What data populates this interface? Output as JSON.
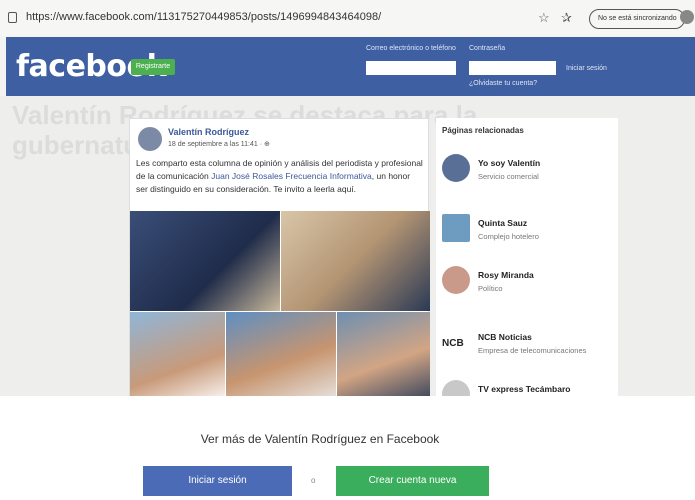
{
  "browser": {
    "url": "https://www.facebook.com/113175270449853/posts/1496994843464098/",
    "profile_status": "No se está sincronizando",
    "icons": [
      "lock-icon",
      "favorite-star-icon",
      "favorites-bar-icon",
      "collections-icon",
      "profile-avatar-icon"
    ]
  },
  "header": {
    "logo": "facebook",
    "register_button": "Registrarte",
    "email_label": "Correo electrónico o teléfono",
    "password_label": "Contraseña",
    "forgot_link": "¿Olvidaste tu cuenta?",
    "login_link": "Iniciar sesión",
    "background_color": "#3f5fa3"
  },
  "background_title": "Valentín Rodríguez se destaca para la gubernatura",
  "post": {
    "author": "Valentín Rodríguez",
    "date": "18 de septiembre a las 11:41 · ",
    "text_before": "Les comparto esta columna de opinión y análisis del periodista y profesional de la comunicación ",
    "mention": "Juan José Rosales Frecuencia Informativa",
    "text_after": ", un honor ser distinguido en su consideración. Te invito a leerla aquí."
  },
  "related_pages": {
    "heading": "Páginas relacionadas",
    "items": [
      {
        "name": "Yo soy Valentín",
        "category": "Servicio comercial"
      },
      {
        "name": "Quinta Sauz",
        "category": "Complejo hotelero"
      },
      {
        "name": "Rosy Miranda",
        "category": "Político"
      },
      {
        "name": "NCB Noticias",
        "category": "Empresa de telecomunicaciones",
        "thumb_label": "NCB"
      },
      {
        "name": "TV express Tecámbaro",
        "category": ""
      }
    ]
  },
  "modal": {
    "title": "Ver más de Valentín Rodríguez en Facebook",
    "login_button": "Iniciar sesión",
    "or_text": "o",
    "create_button": "Crear cuenta nueva"
  }
}
